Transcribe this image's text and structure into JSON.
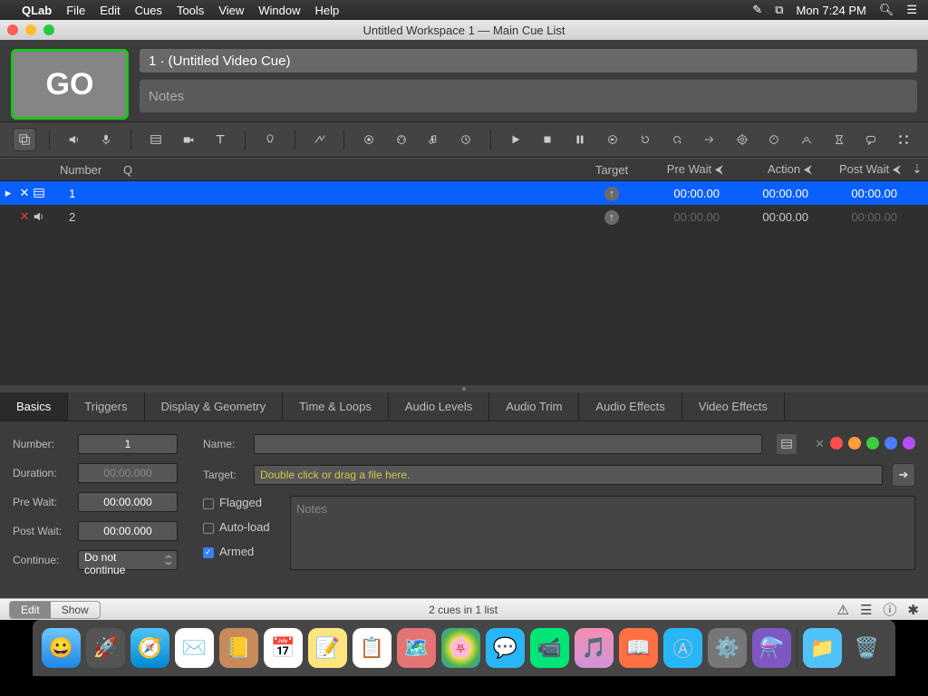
{
  "menubar": {
    "app": "QLab",
    "items": [
      "File",
      "Edit",
      "Cues",
      "Tools",
      "View",
      "Window",
      "Help"
    ],
    "clock": "Mon 7:24 PM"
  },
  "window_title": "Untitled Workspace 1 — Main Cue List",
  "go_label": "GO",
  "cue_title": "1 · (Untitled Video Cue)",
  "notes_placeholder": "Notes",
  "columns": {
    "number": "Number",
    "q": "Q",
    "target": "Target",
    "prewait": "Pre Wait",
    "action": "Action",
    "postwait": "Post Wait"
  },
  "cues": [
    {
      "num": "1",
      "broken": true,
      "type": "video",
      "target": "↑",
      "prewait": "00:00.00",
      "action": "00:00.00",
      "postwait": "00:00.00",
      "selected": true
    },
    {
      "num": "2",
      "broken": true,
      "type": "audio",
      "target": "↑",
      "prewait": "00:00.00",
      "action": "00:00.00",
      "postwait": "00:00.00",
      "selected": false,
      "dim_pw": true,
      "dim_post": true
    }
  ],
  "tabs": [
    "Basics",
    "Triggers",
    "Display & Geometry",
    "Time & Loops",
    "Audio Levels",
    "Audio Trim",
    "Audio Effects",
    "Video Effects"
  ],
  "active_tab": 0,
  "inspector": {
    "number_label": "Number:",
    "number": "1",
    "duration_label": "Duration:",
    "duration": "00:00.000",
    "prewait_label": "Pre Wait:",
    "prewait": "00:00.000",
    "postwait_label": "Post Wait:",
    "postwait": "00:00.000",
    "continue_label": "Continue:",
    "continue_value": "Do not continue",
    "name_label": "Name:",
    "name": "",
    "target_label": "Target:",
    "target_hint": "Double click or drag a file here.",
    "flagged_label": "Flagged",
    "flagged": false,
    "autoload_label": "Auto-load",
    "autoload": false,
    "armed_label": "Armed",
    "armed": true,
    "notes_placeholder": "Notes"
  },
  "footer": {
    "edit": "Edit",
    "show": "Show",
    "status": "2 cues in 1 list"
  },
  "colors": {
    "red": "#ff4d4d",
    "orange": "#ff9e3d",
    "yellow": "#ffd23d",
    "green": "#3dcb3d",
    "blue": "#4d7dff",
    "purple": "#b84dff",
    "grayX": "#888"
  }
}
